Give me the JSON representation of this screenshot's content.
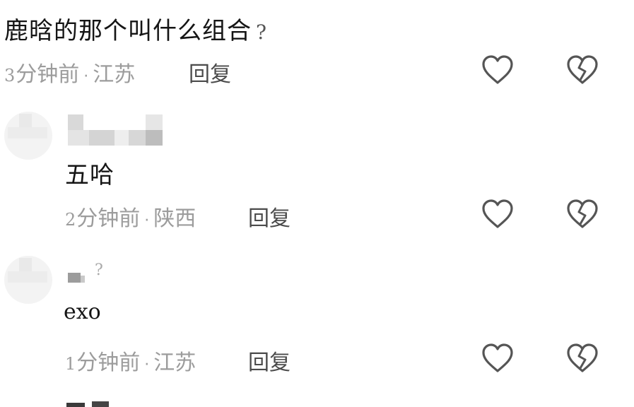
{
  "comments": [
    {
      "text": "鹿晗的那个叫什么组合",
      "text_suffix": "?",
      "time_num": "3",
      "time_label": "分钟前",
      "location": "江苏",
      "reply_label": "回复"
    },
    {
      "text": "五哈",
      "time_num": "2",
      "time_label": "分钟前",
      "location": "陕西",
      "reply_label": "回复"
    },
    {
      "username_suffix": "?",
      "text": "exo",
      "time_num": "1",
      "time_label": "分钟前",
      "location": "江苏",
      "reply_label": "回复"
    }
  ],
  "separator": "·",
  "icons": {
    "like": "heart-outline-icon",
    "dislike": "broken-heart-icon"
  },
  "colors": {
    "meta": "#9c9c9c",
    "icon_stroke": "#555555",
    "text": "#151515"
  }
}
